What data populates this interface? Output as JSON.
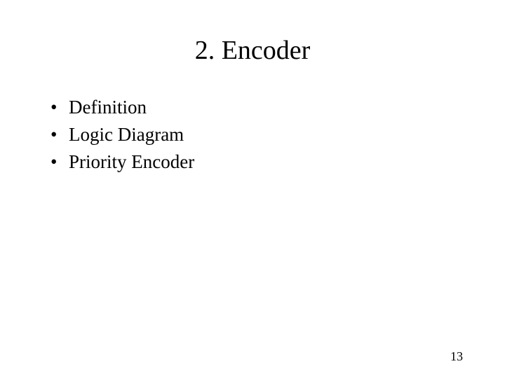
{
  "slide": {
    "title": "2. Encoder",
    "bullets": [
      "Definition",
      "Logic Diagram",
      "Priority Encoder"
    ],
    "page_number": "13"
  }
}
